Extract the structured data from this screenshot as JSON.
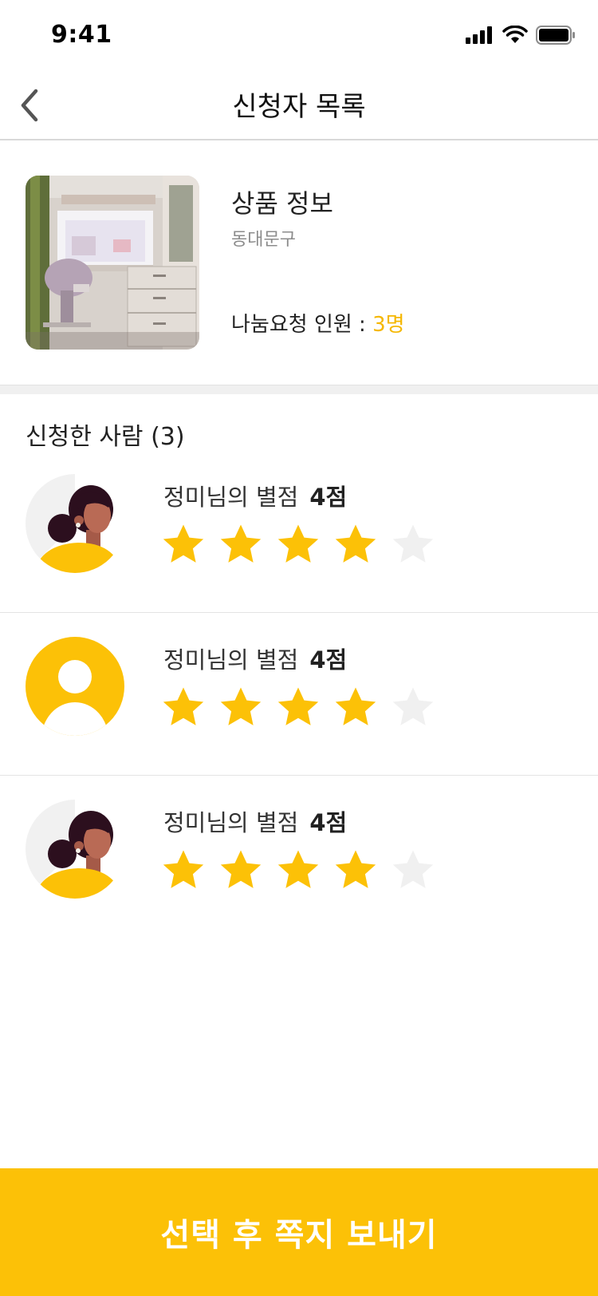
{
  "status_bar": {
    "time": "9:41"
  },
  "header": {
    "title": "신청자 목록"
  },
  "product": {
    "title": "상품 정보",
    "location": "동대문구",
    "request_label": "나눔요청 인원 : ",
    "request_count": "3명"
  },
  "applicants_section": {
    "title": "신청한 사람 (3)",
    "items": [
      {
        "label": "정미님의 별점",
        "score": "4점",
        "rating": 4,
        "max": 5,
        "avatar": "woman-avatar-icon"
      },
      {
        "label": "정미님의 별점",
        "score": "4점",
        "rating": 4,
        "max": 5,
        "avatar": "default-user-icon"
      },
      {
        "label": "정미님의 별점",
        "score": "4점",
        "rating": 4,
        "max": 5,
        "avatar": "woman-avatar-icon"
      }
    ]
  },
  "send_button": {
    "label": "선택 후 쪽지 보내기"
  },
  "colors": {
    "accent": "#FCC107",
    "star_on": "#FCC107",
    "star_off": "#F0F0F0",
    "count_text": "#F5B700"
  }
}
